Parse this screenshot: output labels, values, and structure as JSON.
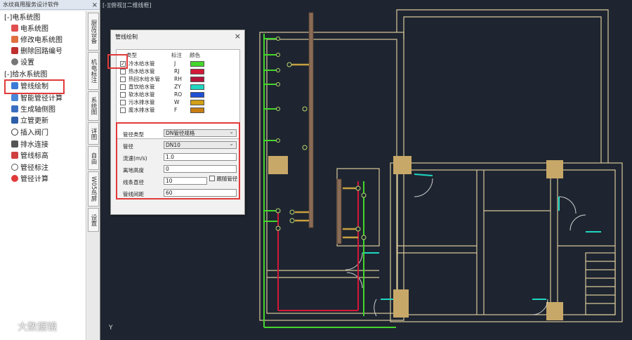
{
  "panel": {
    "title": "水纹商用服务设计软件",
    "close": "×",
    "groups": [
      {
        "label": "[-]电系统图",
        "items": [
          "电系统图",
          "修改电系统图",
          "删除回路编号",
          "设置"
        ]
      },
      {
        "label": "[-]给水系统图",
        "items": [
          "管线绘制",
          "智能管径计算",
          "生成轴侧图",
          "立管更新",
          "插入阀门",
          "排水连接",
          "管线标高",
          "管径标注",
          "管径计算"
        ]
      }
    ],
    "tabs": [
      "厨房设备",
      "机电标注",
      "系统图",
      "详图",
      "自由",
      "W05鸟屏",
      "设置"
    ]
  },
  "canvas": {
    "view_label": "[-][俯视][二维线框]",
    "axis_label": "Y",
    "watermark": "大数据镜"
  },
  "dialog": {
    "title": "管线绘制",
    "close": "×",
    "headers": {
      "type": "类型",
      "code": "标注",
      "color": "颜色"
    },
    "pipes": [
      {
        "name": "冷水给水管",
        "code": "J",
        "color": "#44d62c",
        "checked": true
      },
      {
        "name": "热水给水管",
        "code": "RJ",
        "color": "#d4183a",
        "checked": false
      },
      {
        "name": "热回水给水管",
        "code": "RH",
        "color": "#b5123a",
        "checked": false
      },
      {
        "name": "直饮给水管",
        "code": "ZY",
        "color": "#1fd6c1",
        "checked": false
      },
      {
        "name": "软水给水管",
        "code": "RO",
        "color": "#1f4fd6",
        "checked": false
      },
      {
        "name": "污水排水管",
        "code": "W",
        "color": "#d1a017",
        "checked": false
      },
      {
        "name": "废水排水管",
        "code": "F",
        "color": "#c77d12",
        "checked": false
      }
    ],
    "params": {
      "diameter_type_label": "管径类型",
      "diameter_type_value": "DN管径规格",
      "diameter_label": "管径",
      "diameter_value": "DN10",
      "flow_label": "流速(m/s)",
      "flow_value": "1.0",
      "height_label": "离地高度",
      "height_value": "0",
      "line_dia_label": "线条直径",
      "line_dia_value": "10",
      "follow_label": "跟随管径",
      "spacing_label": "管线间距",
      "spacing_value": "60"
    }
  },
  "colors": {
    "wall": "#d8c89a",
    "column": "#c8a868",
    "cold": "#44d62c",
    "hot": "#d4183a",
    "door": "#1fd6c1",
    "highlight": "#e23a3a"
  }
}
